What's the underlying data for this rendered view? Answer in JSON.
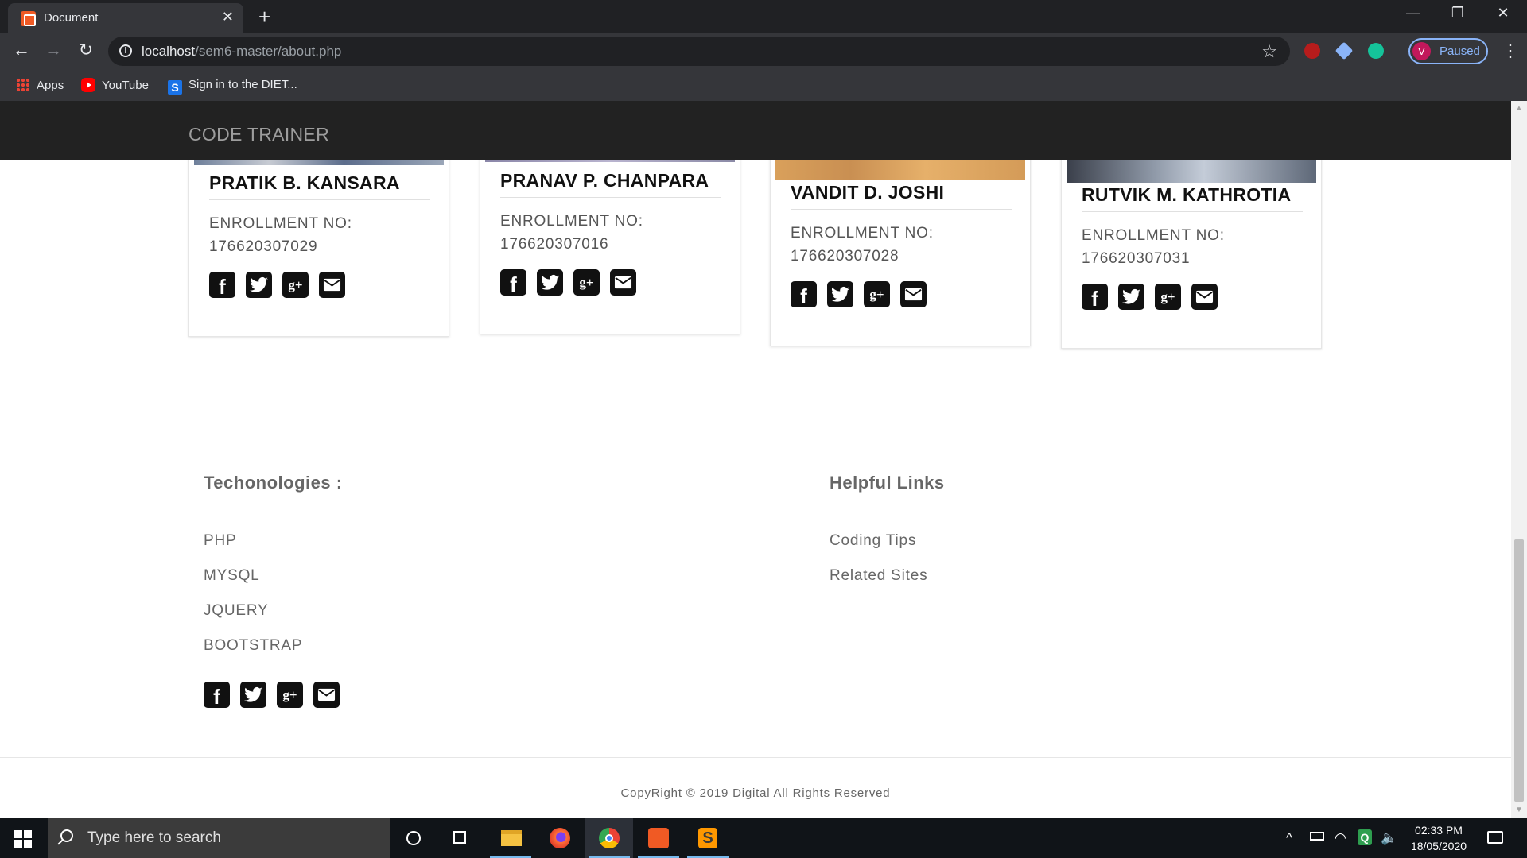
{
  "browser": {
    "tab_title": "Document",
    "tab_close": "✕",
    "new_tab": "+",
    "window_controls": {
      "minimize": "—",
      "restore": "❐",
      "close": "✕"
    },
    "url_host": "localhost",
    "url_path": "/sem6-master/about.php",
    "profile_initial": "V",
    "profile_status": "Paused",
    "bookmarks": [
      {
        "label": "Apps",
        "icon": "apps-grid-icon"
      },
      {
        "label": "YouTube",
        "icon": "youtube-icon"
      },
      {
        "label": "Sign in to the DIET...",
        "icon": "s-icon"
      }
    ],
    "extensions": [
      {
        "name": "ublock-icon",
        "color": "#b71c1c"
      },
      {
        "name": "diamond-icon",
        "color": "#8ab4f8"
      },
      {
        "name": "grammarly-icon",
        "color": "#15c39a"
      }
    ]
  },
  "site": {
    "brand": "CODE TRAINER",
    "members": [
      {
        "name": "PRATIK B. KANSARA",
        "enrollment_label": "ENROLLMENT NO:",
        "enrollment_no": "176620307029"
      },
      {
        "name": "PRANAV P. CHANPARA",
        "enrollment_label": "ENROLLMENT NO:",
        "enrollment_no": "176620307016"
      },
      {
        "name": "VANDIT D. JOSHI",
        "enrollment_label": "ENROLLMENT NO:",
        "enrollment_no": "176620307028"
      },
      {
        "name": "RUTVIK M. KATHROTIA",
        "enrollment_label": "ENROLLMENT NO:",
        "enrollment_no": "176620307031"
      }
    ],
    "social_icons": [
      "facebook-icon",
      "twitter-icon",
      "google-plus-icon",
      "email-icon"
    ],
    "footer": {
      "tech_title": "Techonologies :",
      "tech_links": [
        "PHP",
        "MYSQL",
        "JQUERY",
        "BOOTSTRAP"
      ],
      "helpful_title": "Helpful Links",
      "helpful_links": [
        "Coding Tips",
        "Related Sites"
      ],
      "copyright": "CopyRight © 2019 Digital All Rights Reserved"
    }
  },
  "taskbar": {
    "search_placeholder": "Type here to search",
    "time": "02:33 PM",
    "date": "18/05/2020"
  }
}
